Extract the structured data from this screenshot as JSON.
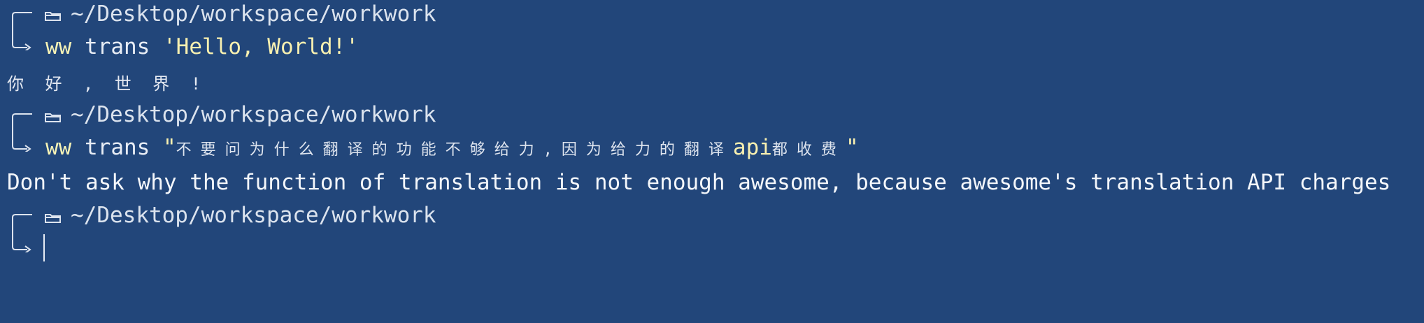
{
  "prompt": {
    "path": "~/Desktop/workspace/workwork",
    "folder_icon": "folder-icon",
    "branch_icon": "prompt-branch-icon"
  },
  "lines": {
    "command_1": {
      "command": "ww",
      "subcommand": "trans",
      "argument": "'Hello, World!'"
    },
    "output_1": "你 好 , 世 界 !",
    "command_2": {
      "command": "ww",
      "subcommand": "trans",
      "argument_open": "\"",
      "argument_zh": "不要问为什么翻译的功能不够给力,因为给力的翻译",
      "argument_api": "api",
      "argument_tail": "都收费",
      "argument_close": "\""
    },
    "output_2": "Don't ask why the function of translation is not enough awesome, because awesome's translation API charges"
  },
  "colors": {
    "background": "#22467a",
    "text": "#e8edf5",
    "command": "#f5f2b6"
  }
}
